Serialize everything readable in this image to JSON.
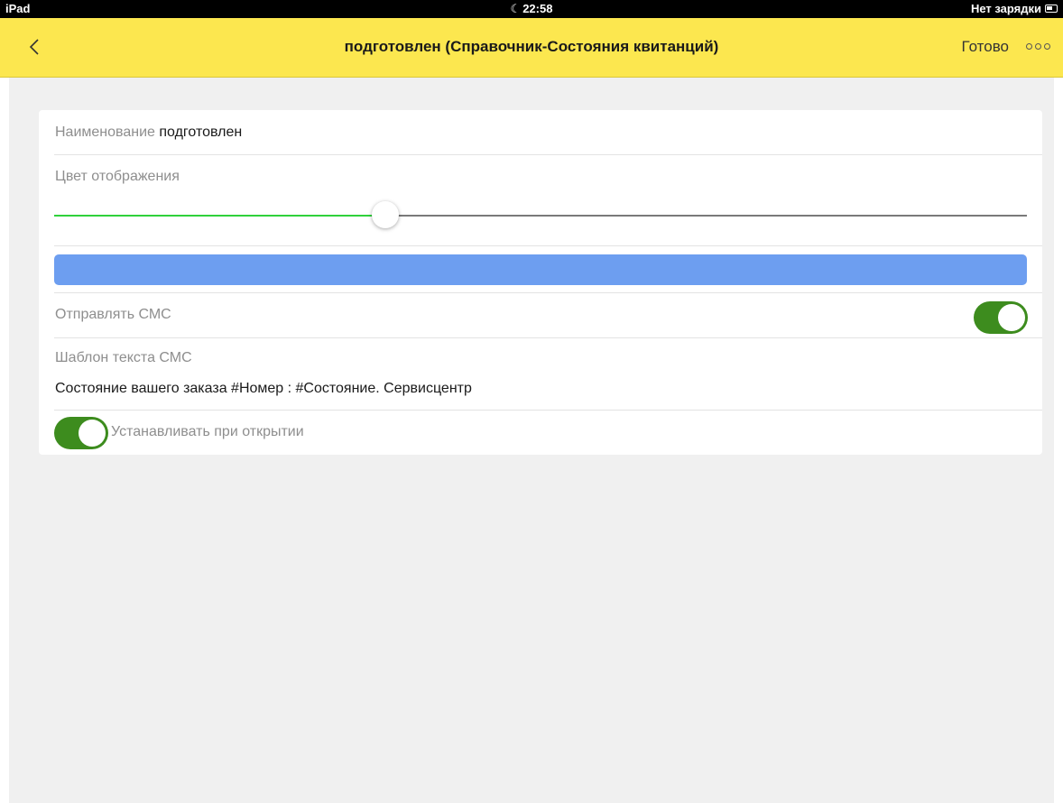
{
  "status_bar": {
    "device": "iPad",
    "time": "22:58",
    "moon_icon": "moon-icon",
    "charging_text": "Нет зарядки",
    "battery_icon": "battery-icon"
  },
  "nav": {
    "back_icon": "chevron-left-icon",
    "title": "подготовлен (Справочник-Состояния квитанций)",
    "done_label": "Готово",
    "more_icon": "ellipsis-icon",
    "background_color": "#fce74f"
  },
  "form": {
    "name_label": "Наименование",
    "name_value": "подготовлен",
    "color_label": "Цвет отображения",
    "color_slider_value": 0.34,
    "slider_active_color": "#2fd13b",
    "color_swatch": "#6d9ef0",
    "send_sms_label": "Отправлять СМС",
    "send_sms_on": true,
    "sms_template_label": "Шаблон текста СМС",
    "sms_template_value": "Состояние вашего заказа #Номер : #Состояние. Сервисцентр",
    "set_on_open_label": "Устанавливать при открытии",
    "set_on_open_on": true,
    "toggle_on_color": "#3d8c1e"
  }
}
